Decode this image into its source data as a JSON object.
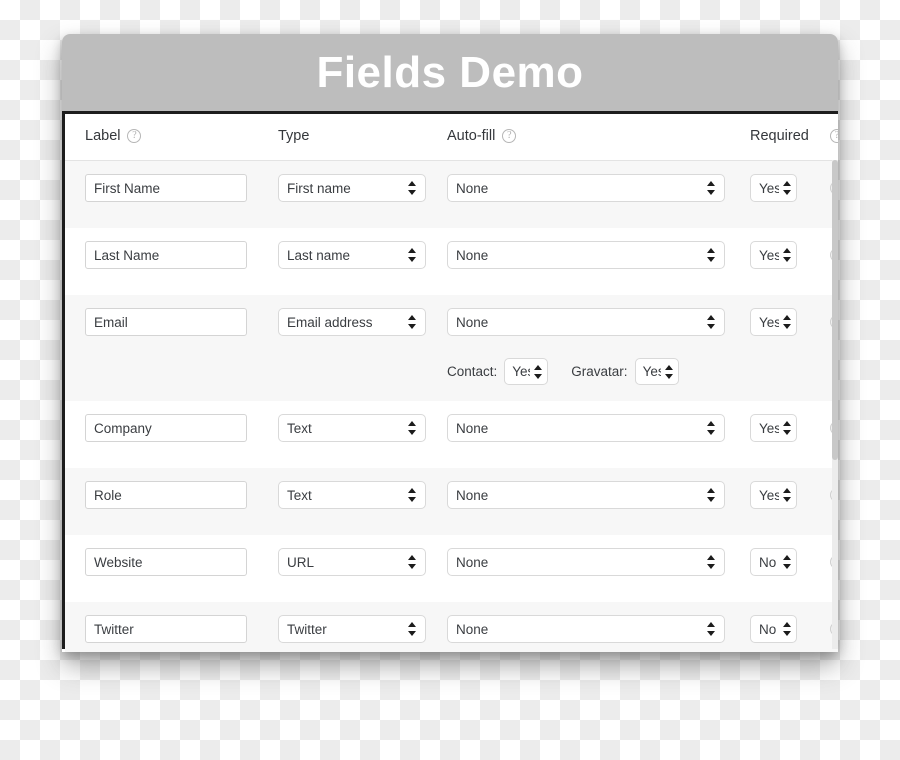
{
  "window": {
    "title": "Fields Demo",
    "titlebar_color": "#bdbdbd",
    "title_text_color": "#ffffff"
  },
  "table": {
    "headers": {
      "label": "Label",
      "type": "Type",
      "autofill": "Auto-fill",
      "required": "Required",
      "help_icon": "?"
    },
    "rows": [
      {
        "label_value": "First Name",
        "type_value": "First name",
        "autofill_value": "None",
        "required_value": "Yes"
      },
      {
        "label_value": "Last Name",
        "type_value": "Last name",
        "autofill_value": "None",
        "required_value": "Yes"
      },
      {
        "label_value": "Email",
        "type_value": "Email address",
        "autofill_value": "None",
        "required_value": "Yes",
        "contact_label": "Contact:",
        "contact_value": "Yes",
        "gravatar_label": "Gravatar:",
        "gravatar_value": "Yes"
      },
      {
        "label_value": "Company",
        "type_value": "Text",
        "autofill_value": "None",
        "required_value": "Yes"
      },
      {
        "label_value": "Role",
        "type_value": "Text",
        "autofill_value": "None",
        "required_value": "Yes"
      },
      {
        "label_value": "Website",
        "type_value": "URL",
        "autofill_value": "None",
        "required_value": "No"
      },
      {
        "label_value": "Twitter",
        "type_value": "Twitter",
        "autofill_value": "None",
        "required_value": "No"
      }
    ]
  }
}
